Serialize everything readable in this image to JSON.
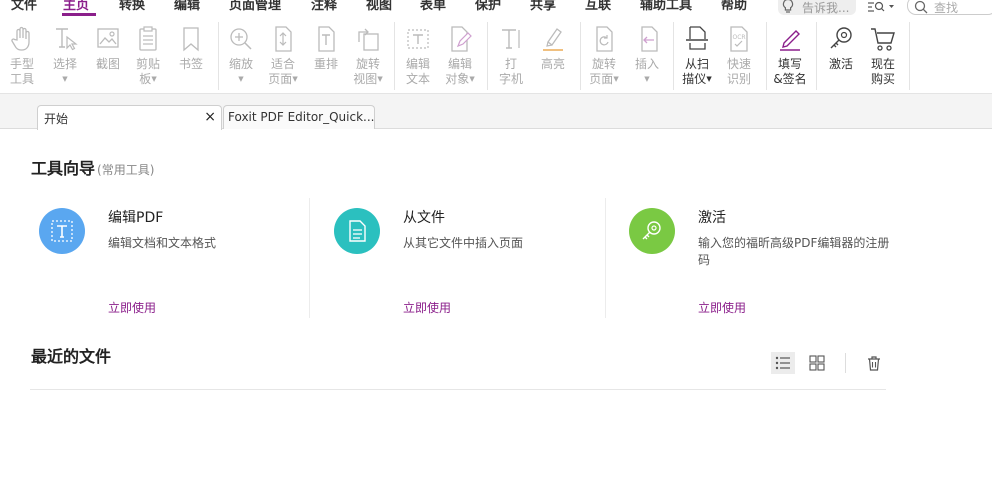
{
  "menu": {
    "items": [
      {
        "label": "文件",
        "active": false
      },
      {
        "label": "主页",
        "active": true
      },
      {
        "label": "转换",
        "active": false
      },
      {
        "label": "编辑",
        "active": false
      },
      {
        "label": "页面管理",
        "active": false
      },
      {
        "label": "注释",
        "active": false
      },
      {
        "label": "视图",
        "active": false
      },
      {
        "label": "表单",
        "active": false
      },
      {
        "label": "保护",
        "active": false
      },
      {
        "label": "共享",
        "active": false
      },
      {
        "label": "互联",
        "active": false
      },
      {
        "label": "辅助工具",
        "active": false
      },
      {
        "label": "帮助",
        "active": false
      }
    ],
    "tell_me_placeholder": "告诉我...",
    "search_placeholder": "查找"
  },
  "toolbar": {
    "tools": [
      {
        "name": "hand-tool",
        "line1": "手型",
        "line2": "工具",
        "enabled": false,
        "icon": "hand-icon"
      },
      {
        "name": "select-tool",
        "line1": "选择",
        "line2": "",
        "enabled": false,
        "icon": "select-cursor-icon",
        "caret": true
      },
      {
        "name": "snapshot-tool",
        "line1": "截图",
        "line2": "",
        "enabled": false,
        "icon": "snapshot-icon"
      },
      {
        "name": "clipboard-tool",
        "line1": "剪贴",
        "line2": "板",
        "enabled": false,
        "icon": "clipboard-icon",
        "caret": true
      },
      {
        "name": "bookmark-tool",
        "line1": "书签",
        "line2": "",
        "enabled": false,
        "icon": "bookmark-icon"
      },
      {
        "name": "zoom-tool",
        "line1": "缩放",
        "line2": "",
        "enabled": false,
        "icon": "zoom-icon",
        "caret": true
      },
      {
        "name": "fit-page-tool",
        "line1": "适合",
        "line2": "页面",
        "enabled": false,
        "icon": "fit-page-icon",
        "caret": true
      },
      {
        "name": "reflow-tool",
        "line1": "重排",
        "line2": "",
        "enabled": false,
        "icon": "reflow-icon"
      },
      {
        "name": "rotate-view-tool",
        "line1": "旋转",
        "line2": "视图",
        "enabled": false,
        "icon": "rotate-view-icon",
        "caret": true
      },
      {
        "name": "edit-text-tool",
        "line1": "编辑",
        "line2": "文本",
        "enabled": false,
        "icon": "edit-text-icon"
      },
      {
        "name": "edit-object-tool",
        "line1": "编辑",
        "line2": "对象",
        "enabled": false,
        "icon": "edit-object-icon",
        "caret": true
      },
      {
        "name": "typewriter-tool",
        "line1": "打",
        "line2": "字机",
        "enabled": false,
        "icon": "typewriter-icon"
      },
      {
        "name": "highlight-tool",
        "line1": "高亮",
        "line2": "",
        "enabled": false,
        "icon": "highlight-icon"
      },
      {
        "name": "rotate-page-tool",
        "line1": "旋转",
        "line2": "页面",
        "enabled": false,
        "icon": "rotate-page-icon",
        "caret": true
      },
      {
        "name": "insert-tool",
        "line1": "插入",
        "line2": "",
        "enabled": false,
        "icon": "insert-page-icon",
        "caret": true
      },
      {
        "name": "from-scanner-tool",
        "line1": "从扫",
        "line2": "描仪",
        "enabled": true,
        "icon": "scanner-icon",
        "caret": true
      },
      {
        "name": "quick-ocr-tool",
        "line1": "快速",
        "line2": "识别",
        "enabled": false,
        "icon": "ocr-icon"
      },
      {
        "name": "fill-sign-tool",
        "line1": "填写",
        "line2": "&签名",
        "enabled": true,
        "icon": "pen-sign-icon"
      },
      {
        "name": "activate-tool",
        "line1": "激活",
        "line2": "",
        "enabled": true,
        "icon": "key-icon"
      },
      {
        "name": "buy-now-tool",
        "line1": "现在",
        "line2": "购买",
        "enabled": true,
        "icon": "cart-icon"
      }
    ]
  },
  "tabs": [
    {
      "label": "开始",
      "active": true,
      "close": "×"
    },
    {
      "label": "Foxit PDF Editor_Quick...",
      "active": false
    }
  ],
  "tools_guide": {
    "title": "工具向导",
    "subtitle": "(常用工具)",
    "cards": [
      {
        "title": "编辑PDF",
        "desc": "编辑文档和文本格式",
        "link": "立即使用",
        "color": "#5aa7f0",
        "icon": "edit-pdf-icon"
      },
      {
        "title": "从文件",
        "desc": "从其它文件中插入页面",
        "link": "立即使用",
        "color": "#2bc0bf",
        "icon": "document-icon"
      },
      {
        "title": "激活",
        "desc": "输入您的福昕高级PDF编辑器的注册码",
        "link": "立即使用",
        "color": "#7ac943",
        "icon": "key-icon"
      }
    ]
  },
  "recent_files": {
    "title": "最近的文件"
  }
}
